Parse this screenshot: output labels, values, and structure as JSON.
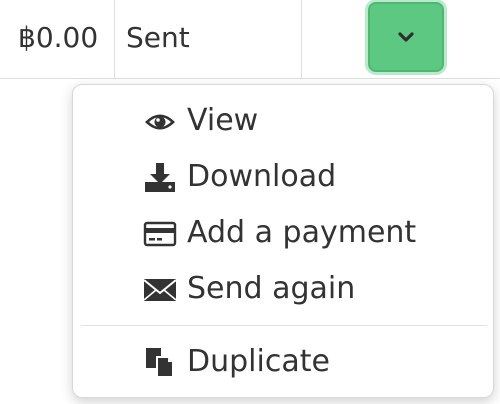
{
  "row": {
    "amount": "฿0.00",
    "status": "Sent"
  },
  "toggle": {
    "icon": "chevron-down-icon",
    "color": "#5cc882"
  },
  "menu": {
    "items": [
      {
        "label": "View",
        "icon": "eye-icon"
      },
      {
        "label": "Download",
        "icon": "download-icon"
      },
      {
        "label": "Add a payment",
        "icon": "credit-card-icon"
      },
      {
        "label": "Send again",
        "icon": "envelope-icon"
      },
      {
        "label": "Duplicate",
        "icon": "copy-icon"
      }
    ]
  }
}
